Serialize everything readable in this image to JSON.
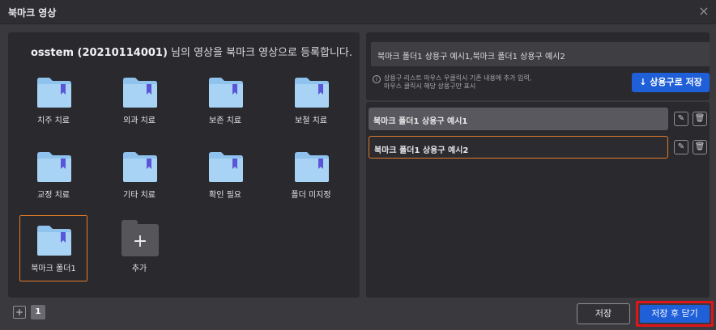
{
  "window": {
    "title": "북마크 영상",
    "close_glyph": "×"
  },
  "left": {
    "heading_bold": "osstem (20210114001)",
    "heading_rest": " 님의 영상을 북마크 영상으로 등록합니다.",
    "folders": [
      {
        "label": "치주 치료"
      },
      {
        "label": "외과 치료"
      },
      {
        "label": "보존 치료"
      },
      {
        "label": "보철 치료"
      },
      {
        "label": "교정 치료"
      },
      {
        "label": "기타 치료"
      },
      {
        "label": "확인 필요"
      },
      {
        "label": "폴더 미지정"
      },
      {
        "label": "북마크 폴더1",
        "selected": true
      }
    ],
    "add_folder": {
      "label": "추가",
      "glyph": "+"
    }
  },
  "right": {
    "input_value": "북마크 폴더1 상용구 예시1,북마크 폴더1 상용구 예시2",
    "hint_line1": "상용구 리스트 마우스 우클릭시 기존 내용에 추가 입력,",
    "hint_line2": "마우스 클릭시 해당 상용구만 표시",
    "info_glyph": "i",
    "save_phrase_label": "↓ 상용구로 저장",
    "phrases": [
      {
        "text": "북마크 폴더1 상용구 예시1"
      },
      {
        "text": "북마크 폴더1 상용구 예시2"
      }
    ],
    "edit_glyph": "✎",
    "delete_glyph": "🗑"
  },
  "bottom": {
    "add_page_glyph": "+",
    "page_number": "1",
    "save_label": "저장",
    "save_close_label": "저장 후 닫기"
  },
  "colors": {
    "accent_blue": "#1f5fd8",
    "selection_orange": "#e07a2a",
    "highlight_red": "#e0151b",
    "folder_blue": "#8fc3ee",
    "bookmark_purple": "#5a55d8"
  },
  "icons": {
    "folder": "folder-bookmark-icon",
    "add": "plus-icon",
    "edit": "pencil-icon",
    "delete": "trash-icon",
    "info": "info-icon",
    "close": "close-icon"
  }
}
